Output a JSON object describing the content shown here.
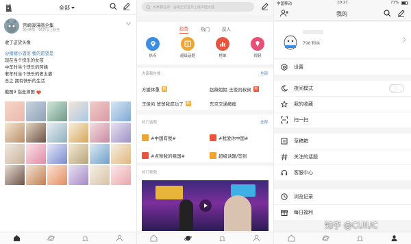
{
  "feed": {
    "header_title": "全部",
    "author": "宫崎骏漫画全集",
    "author_meta": "9分钟前 · 96万以上粉丝",
    "lines": [
      "收了这货头像",
      "@猪猪小酒馆 我的愿望是",
      "现在当个快乐的女孩",
      "中年时当个快乐的阿姨",
      "老年时当个快乐的老太婆",
      "总之 拥有快乐的生活",
      "截图9 指走源图"
    ]
  },
  "discover": {
    "search_placeholder": "大家都在搜：谷歌正式宣布上线中国大陆",
    "tabs": [
      "趋势",
      "热门",
      "获人"
    ],
    "categories": [
      {
        "label": "热点",
        "color": "#3a8ee6"
      },
      {
        "label": "超级话题",
        "color": "#f0a52f"
      },
      {
        "label": "榜单",
        "color": "#e8543e"
      },
      {
        "label": "视频",
        "color": "#e94e77"
      }
    ],
    "trending_title": "大家都在搜",
    "more": "全部",
    "trending": [
      {
        "text": "方媛体重",
        "badge": "新"
      },
      {
        "text": "赵薇姐姐 王俊凯叔叔",
        "badge": "热"
      },
      {
        "text": "王俊凯 爸爸我成功了",
        "badge": "新"
      },
      {
        "text": "东京交通瘫痪",
        "badge": ""
      }
    ],
    "topics_title": "热门话题",
    "topics": [
      "#中国有我#",
      "#我爱你中国#",
      "#点赞我的祖国#",
      "超级话题/签到"
    ],
    "video_title": "热门视频"
  },
  "me": {
    "status_carrier": "中国移动",
    "status_time": "10:27",
    "status_battery": "71%",
    "title": "我的",
    "followers": "798 粉丝",
    "menu": [
      "设置",
      "夜间模式",
      "我的收藏",
      "扫一扫",
      "草稿箱",
      "关注的话题",
      "客服中心",
      "浏览记录",
      "每日福利"
    ],
    "watermark": "知乎 @CUIUC"
  }
}
